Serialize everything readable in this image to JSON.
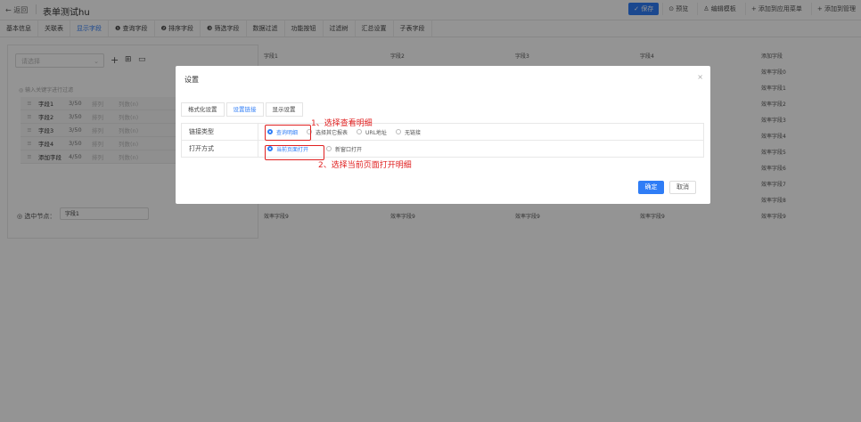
{
  "header": {
    "back_label": "← 返回",
    "title": "表单测试hu",
    "actions": [
      "✓ 保存",
      "⊙ 预览",
      "♙ 编辑模板",
      "+ 添加到应用菜单",
      "+ 添加到管理"
    ]
  },
  "tabs": [
    "基本信息",
    "关联表",
    "显示字段",
    "❶ 查询字段",
    "❷ 排序字段",
    "❸ 筛选字段",
    "数据过滤",
    "功能按钮",
    "过滤树",
    "汇总设置",
    "子表字段"
  ],
  "left_panel": {
    "select_placeholder": "请选择",
    "filter_hint": "◎ 输入关键字进行过滤",
    "fields": [
      {
        "name": "字段1",
        "count": "3/50",
        "a": "排列",
        "b": "列数(n)"
      },
      {
        "name": "字段2",
        "count": "3/50",
        "a": "排列",
        "b": "列数(n)"
      },
      {
        "name": "字段3",
        "count": "3/50",
        "a": "排列",
        "b": "列数(n)"
      },
      {
        "name": "字段4",
        "count": "3/50",
        "a": "排列",
        "b": "列数(n)"
      },
      {
        "name": "添加字段",
        "count": "4/50",
        "a": "排列",
        "b": "列数(n)"
      }
    ],
    "node_label": "◎ 选中节点：",
    "node_value": "字段1"
  },
  "grid": {
    "headers": [
      "字段1",
      "字段2",
      "字段3",
      "字段4",
      "添加字段"
    ],
    "right_col": [
      "效率字段0",
      "效率字段1",
      "效率字段2",
      "效率字段3",
      "效率字段4",
      "效率字段5",
      "效率字段6",
      "效率字段7",
      "效率字段8",
      "效率字段9"
    ],
    "bottom_row": [
      "效率字段9",
      "效率字段9",
      "效率字段9",
      "效率字段9"
    ]
  },
  "modal": {
    "title": "设置",
    "close": "×",
    "tabs": [
      "格式化设置",
      "设置链接",
      "显示设置"
    ],
    "link_type_label": "链接类型",
    "link_options": [
      "查询明细",
      "选择其它报表",
      "URL地址",
      "无链接"
    ],
    "open_mode_label": "打开方式",
    "open_options": [
      "当前页面打开",
      "新窗口打开"
    ],
    "annotation_1": "1、选择查看明细",
    "annotation_2": "2、选择当前页面打开明细",
    "ok": "确定",
    "cancel": "取消"
  },
  "colors": {
    "primary": "#2f7df6",
    "highlight": "#e02020"
  }
}
